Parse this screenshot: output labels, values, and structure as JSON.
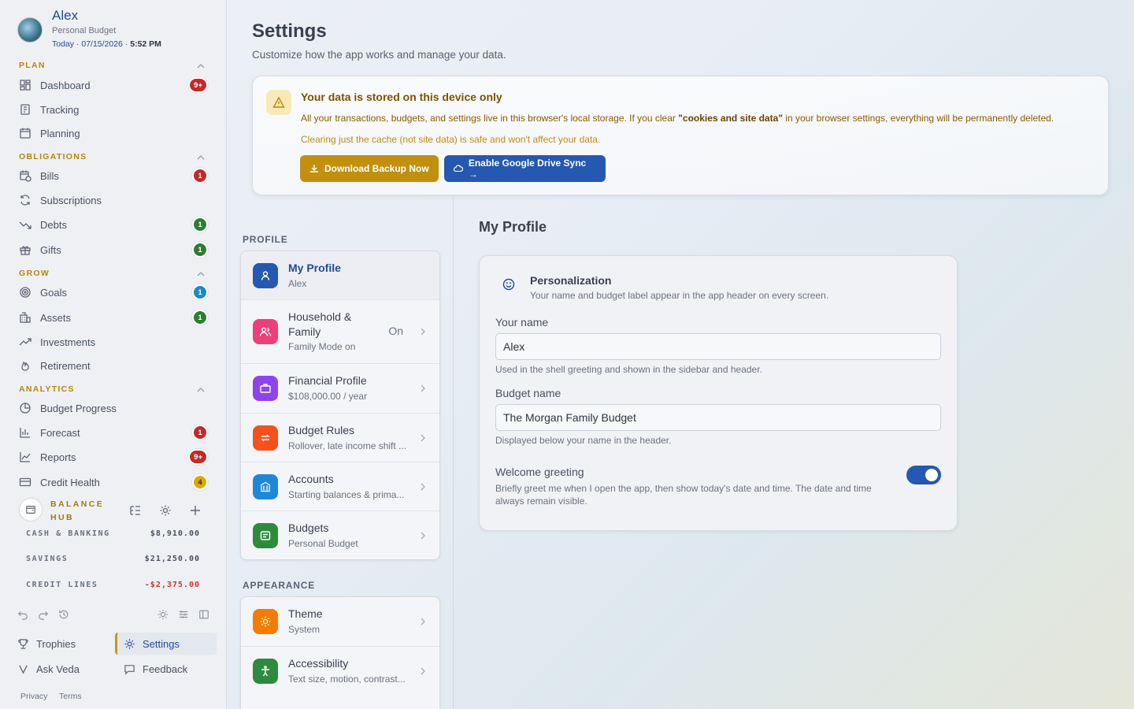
{
  "user": {
    "name": "Alex",
    "budget_label": "Personal Budget",
    "date_prefix": "Today · 07/15/2026 ·",
    "time": "5:52 PM"
  },
  "sidebar": {
    "sections": [
      {
        "title": "PLAN",
        "items": [
          {
            "label": "Dashboard",
            "icon": "dashboard-icon",
            "badge": "9+",
            "badge_color": "#c62828"
          },
          {
            "label": "Tracking",
            "icon": "receipt-icon"
          },
          {
            "label": "Planning",
            "icon": "calendar-icon"
          }
        ]
      },
      {
        "title": "OBLIGATIONS",
        "items": [
          {
            "label": "Bills",
            "icon": "calendar-clock-icon",
            "badge": "1",
            "badge_color": "#c62828"
          },
          {
            "label": "Subscriptions",
            "icon": "refresh-icon"
          },
          {
            "label": "Debts",
            "icon": "trending-down-icon",
            "badge": "1",
            "badge_color": "#2e7d32"
          },
          {
            "label": "Gifts",
            "icon": "gift-icon",
            "badge": "1",
            "badge_color": "#2e7d32"
          }
        ]
      },
      {
        "title": "GROW",
        "items": [
          {
            "label": "Goals",
            "icon": "target-icon",
            "badge": "1",
            "badge_color": "#1e88c8"
          },
          {
            "label": "Assets",
            "icon": "building-icon",
            "badge": "1",
            "badge_color": "#2e7d32"
          },
          {
            "label": "Investments",
            "icon": "trending-up-icon"
          },
          {
            "label": "Retirement",
            "icon": "flame-icon"
          }
        ]
      },
      {
        "title": "ANALYTICS",
        "items": [
          {
            "label": "Budget Progress",
            "icon": "pie-chart-icon"
          },
          {
            "label": "Forecast",
            "icon": "bar-chart-icon",
            "badge": "1",
            "badge_color": "#c62828"
          },
          {
            "label": "Reports",
            "icon": "line-chart-icon",
            "badge": "9+",
            "badge_color": "#c62828"
          },
          {
            "label": "Credit Health",
            "icon": "credit-card-icon",
            "badge": "4",
            "badge_color": "#e0a800"
          }
        ]
      }
    ],
    "balance_hub": {
      "title": "BALANCE HUB",
      "rows": [
        {
          "label": "CASH & BANKING",
          "value": "$8,910.00"
        },
        {
          "label": "SAVINGS",
          "value": "$21,250.00"
        },
        {
          "label": "CREDIT LINES",
          "value": "-$2,375.00"
        }
      ]
    },
    "footer": {
      "trophies": "Trophies",
      "settings": "Settings",
      "ask": "Ask Veda",
      "feedback": "Feedback",
      "privacy": "Privacy",
      "terms": "Terms"
    }
  },
  "page": {
    "title": "Settings",
    "subtitle": "Customize how the app works and manage your data."
  },
  "alert": {
    "title": "Your data is stored on this device only",
    "body_pre": "All your transactions, budgets, and settings live in this browser's local storage. If you clear ",
    "body_bold": "\"cookies and site data\"",
    "body_post": " in your browser settings, everything will be permanently deleted.",
    "note": "Clearing just the cache (not site data) is safe and won't affect your data.",
    "backup_button": "Download Backup Now",
    "sync_button": "Enable Google Drive Sync →"
  },
  "settings_nav": {
    "profile_label": "PROFILE",
    "appearance_label": "APPEARANCE",
    "profile_items": [
      {
        "title": "My Profile",
        "subtitle": "Alex",
        "color": "#2558b0",
        "icon": "user-icon"
      },
      {
        "title": "Household & Family",
        "subtitle": "Family Mode on",
        "status": "On",
        "color": "#ec407a",
        "icon": "users-icon"
      },
      {
        "title": "Financial Profile",
        "subtitle": "$108,000.00 / year",
        "color": "#8e44ec",
        "icon": "briefcase-icon"
      },
      {
        "title": "Budget Rules",
        "subtitle": "Rollover, late income shift ...",
        "color": "#f4511e",
        "icon": "repeat-icon"
      },
      {
        "title": "Accounts",
        "subtitle": "Starting balances & prima...",
        "color": "#1e88d8",
        "icon": "bank-icon"
      },
      {
        "title": "Budgets",
        "subtitle": "Personal Budget",
        "color": "#2e8b3e",
        "icon": "wallet-icon"
      }
    ],
    "appearance_items": [
      {
        "title": "Theme",
        "subtitle": "System",
        "color": "#f57c00",
        "icon": "sun-icon"
      },
      {
        "title": "Accessibility",
        "subtitle": "Text size, motion, contrast...",
        "color": "#2e8b3e",
        "icon": "accessibility-icon"
      }
    ]
  },
  "profile": {
    "heading": "My Profile",
    "section_title": "Personalization",
    "section_sub": "Your name and budget label appear in the app header on every screen.",
    "name_label": "Your name",
    "name_value": "Alex",
    "name_help": "Used in the shell greeting and shown in the sidebar and header.",
    "budget_label": "Budget name",
    "budget_value": "The Morgan Family Budget",
    "budget_help": "Displayed below your name in the header.",
    "greeting_label": "Welcome greeting",
    "greeting_desc": "Briefly greet me when I open the app, then show today's date and time. The date and time always remain visible.",
    "greeting_enabled": true
  }
}
